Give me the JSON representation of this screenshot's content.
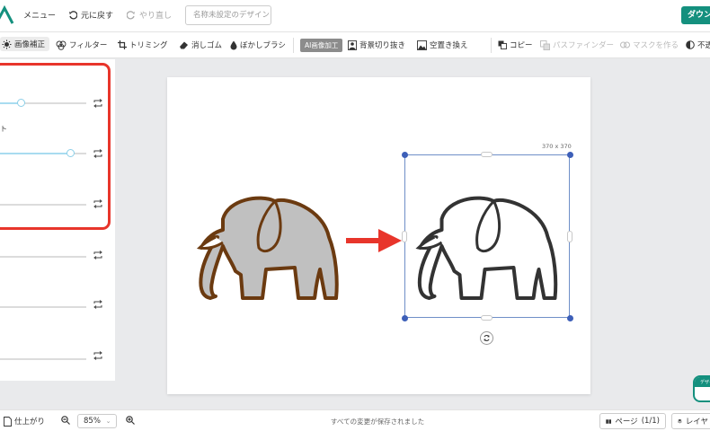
{
  "topbar": {
    "menu_label": "メニュー",
    "undo_label": "元に戻す",
    "redo_label": "やり直し",
    "doc_title": "名称未設定のデザイン",
    "download_label": "ダウン"
  },
  "toolbar": {
    "image_adjust": "画像補正",
    "filter": "フィルター",
    "trim": "トリミング",
    "eraser": "消しゴム",
    "blur_brush": "ぼかしブラシ",
    "ai_badge": "AI画像加工",
    "bg_remove": "背景切り抜き",
    "space_replace": "空置き換え",
    "copy": "コピー",
    "pathfinder": "パスファインダー",
    "make_mask": "マスクを作る",
    "opacity": "不透"
  },
  "panel": {
    "label_partial": "ト",
    "sliders": [
      {
        "value": 0.24
      },
      {
        "value": 0.81
      },
      {
        "value": 0.0
      },
      {
        "value": 0.0
      },
      {
        "value": 0.0
      },
      {
        "value": 0.0
      }
    ]
  },
  "canvas": {
    "selection_size": "370 x 370",
    "colors": {
      "original_fill": "#c0c0c0",
      "original_stroke": "#6b3a10",
      "processed_stroke": "#333333",
      "arrow": "#e8352b",
      "selection": "#3d5fb8"
    }
  },
  "widget": {
    "label": "デザイ"
  },
  "bottombar": {
    "finish_label": "仕上がり",
    "zoom": "85%",
    "status": "すべての変更が保存されました",
    "page_label": "ページ",
    "page_count": "(1/1)",
    "layer_label": "レイヤ"
  }
}
